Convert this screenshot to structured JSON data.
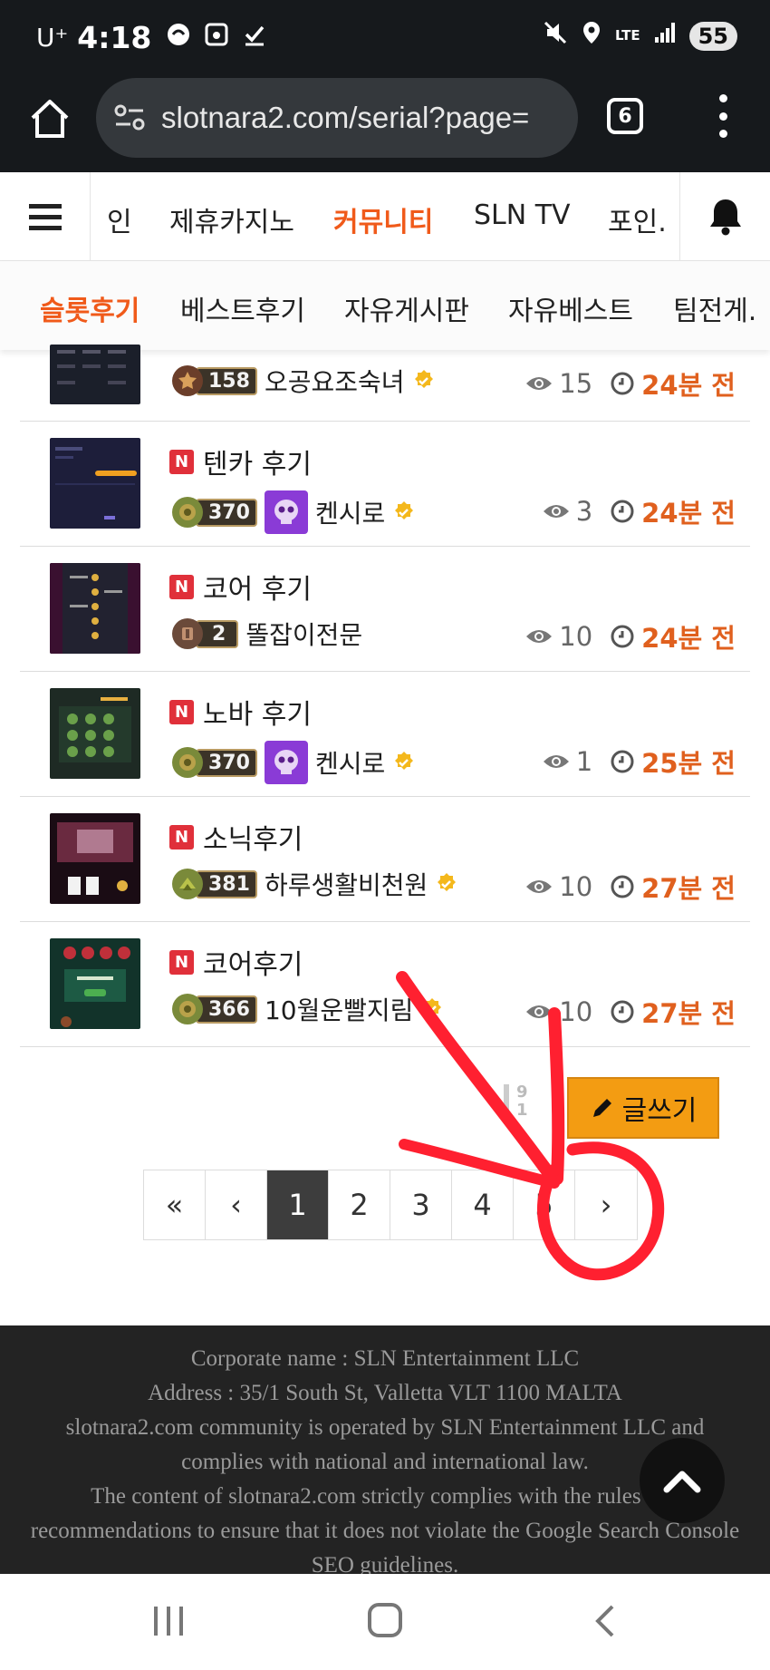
{
  "status_bar": {
    "carrier": "U⁺",
    "time": "4:18",
    "network": "LTE",
    "battery": "55"
  },
  "browser": {
    "url": "slotnara2.com/serial?page=",
    "tab_count": "6"
  },
  "site_nav": {
    "items": [
      "인",
      "제휴카지노",
      "커뮤니티",
      "SLN TV",
      "포인."
    ],
    "active_index": 2
  },
  "sub_nav": {
    "items": [
      "슬롯후기",
      "베스트후기",
      "자유게시판",
      "자유베스트",
      "팀전게."
    ],
    "active_index": 0
  },
  "posts": [
    {
      "title": "",
      "level": "158",
      "nickname": "오공요조숙녀",
      "has_avatar": false,
      "views": "15",
      "time": "24분 전"
    },
    {
      "title": "텐카 후기",
      "level": "370",
      "nickname": "켄시로",
      "has_avatar": true,
      "views": "3",
      "time": "24분 전"
    },
    {
      "title": "코어 후기",
      "level": "2",
      "nickname": "똘잡이전문",
      "has_avatar": false,
      "views": "10",
      "time": "24분 전"
    },
    {
      "title": "노바 후기",
      "level": "370",
      "nickname": "켄시로",
      "has_avatar": true,
      "views": "1",
      "time": "25분 전"
    },
    {
      "title": "소닉후기",
      "level": "381",
      "nickname": "하루생활비천원",
      "has_avatar": false,
      "views": "10",
      "time": "27분 전"
    },
    {
      "title": "코어후기",
      "level": "366",
      "nickname": "10월운빨지림",
      "has_avatar": false,
      "views": "10",
      "time": "27분 전"
    }
  ],
  "counter": {
    "top": "9",
    "bottom": "1"
  },
  "write_button": {
    "label": "글쓰기"
  },
  "pagination": {
    "first": "«",
    "prev": "‹",
    "pages": [
      "1",
      "2",
      "3",
      "4",
      "5"
    ],
    "next": "›",
    "current": "1"
  },
  "footer": {
    "lines": [
      "Corporate name : SLN Entertainment LLC",
      "Address : 35/1 South St, Valletta VLT 1100 MALTA",
      "slotnara2.com community is operated by SLN Entertainment LLC and complies with national and international law.",
      "The content of slotnara2.com strictly complies with the rules and recommendations to ensure that it does not violate the Google Search Console SEO guidelines."
    ]
  },
  "colors": {
    "accent": "#f05a1a",
    "time": "#e0601e",
    "write_button": "#f39c12",
    "annotation": "#ff2030",
    "header_bg": "#16191c",
    "footer_bg": "#232323"
  }
}
